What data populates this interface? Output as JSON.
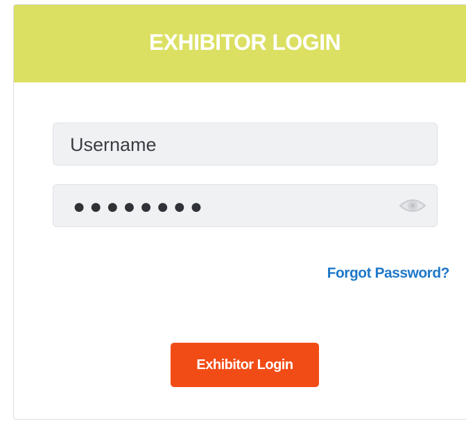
{
  "header": {
    "title": "EXHIBITOR LOGIN"
  },
  "form": {
    "username": {
      "value": "",
      "placeholder": "Username"
    },
    "password": {
      "masked_value": "●●●●●●●●",
      "toggle_icon": "eye-icon"
    },
    "forgot_password_label": "Forgot Password?",
    "submit_label": "Exhibitor Login"
  },
  "colors": {
    "header_bg": "#dbe063",
    "button_bg": "#f24c16",
    "link": "#1f78c8"
  }
}
